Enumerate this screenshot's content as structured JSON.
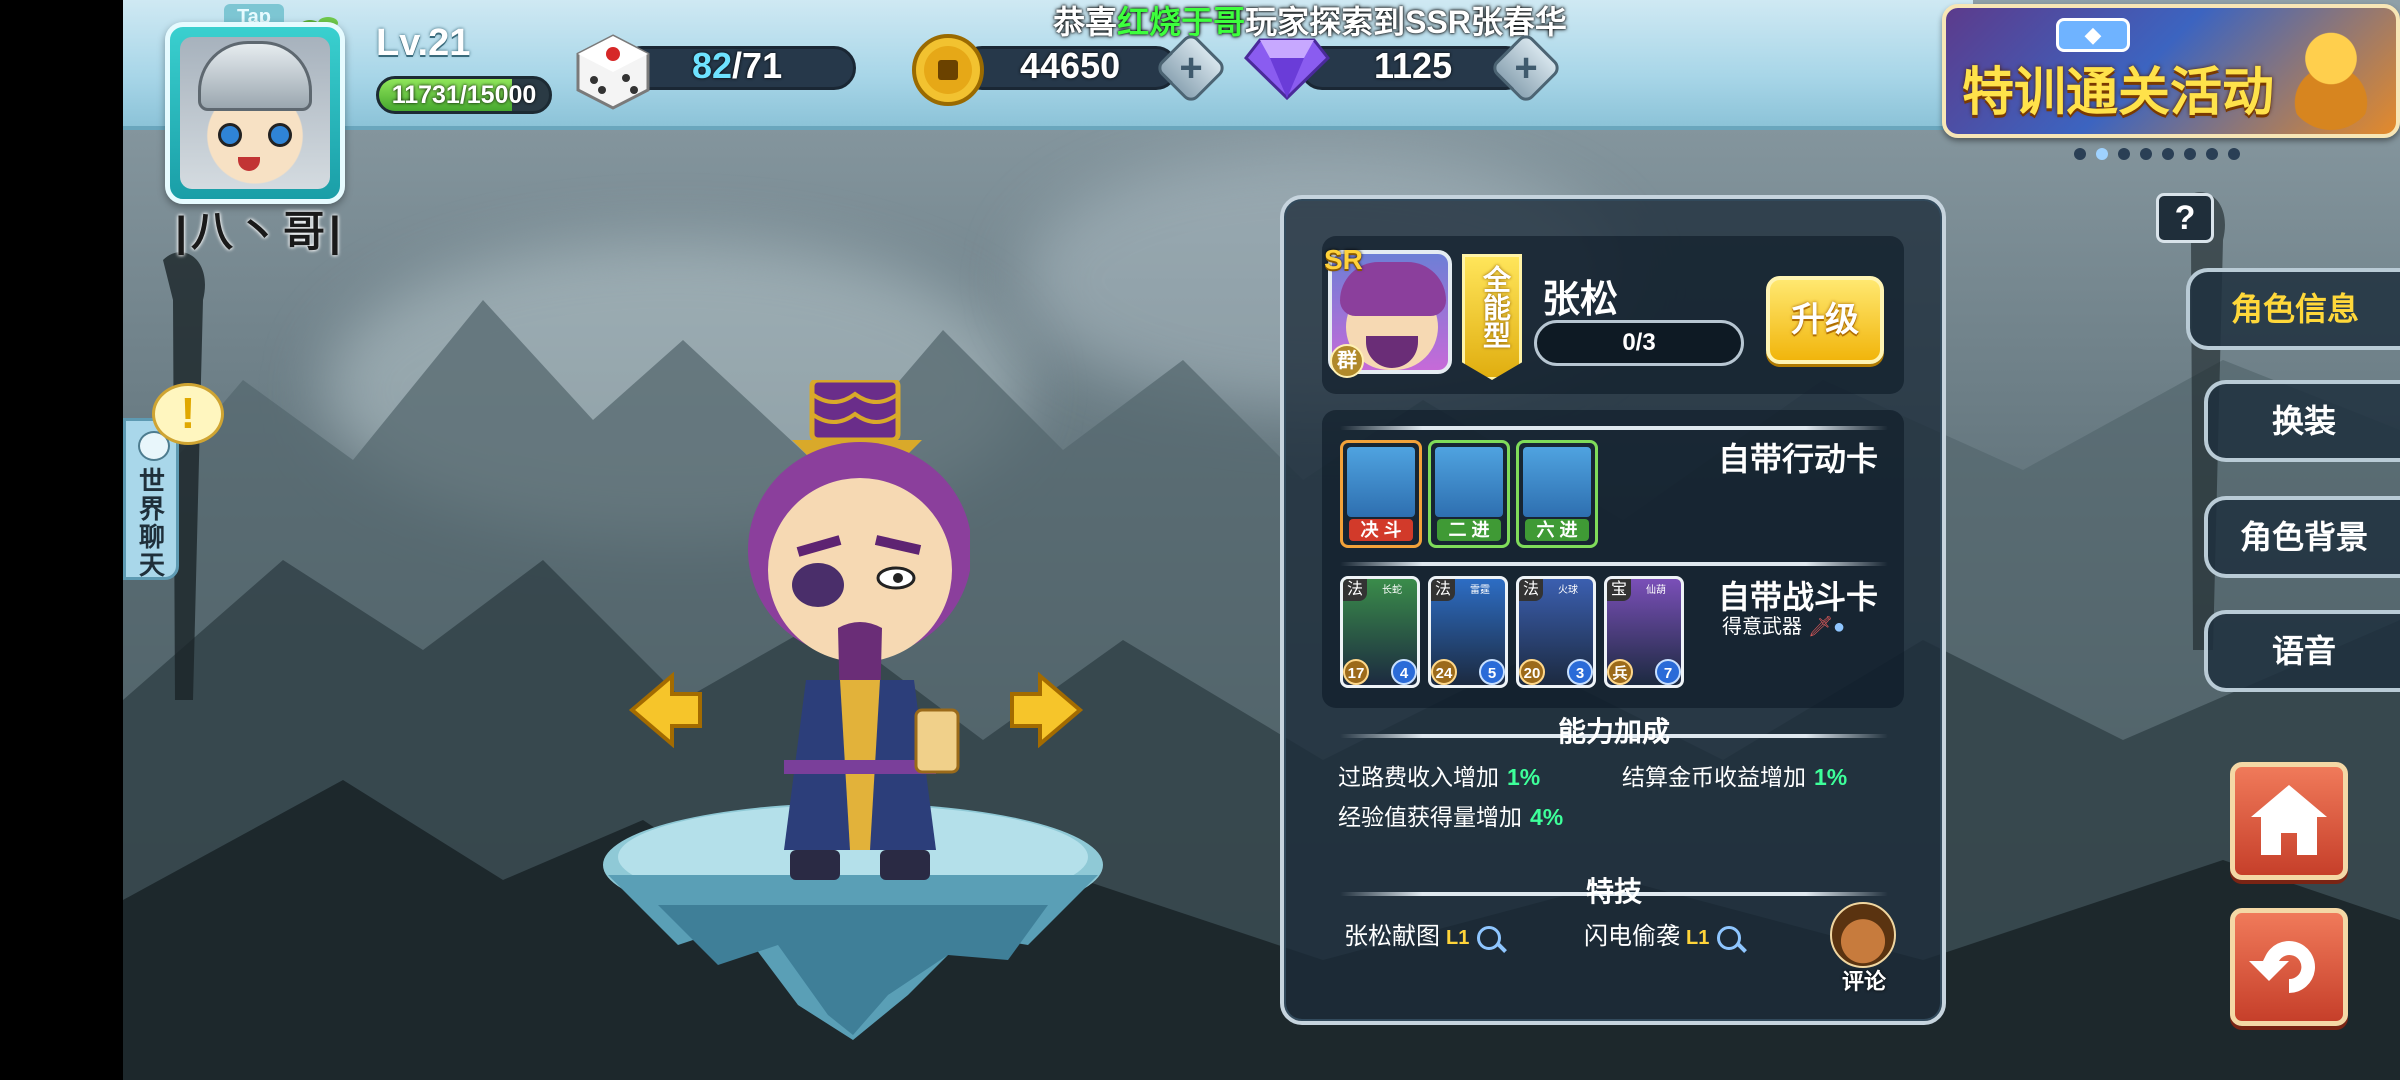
{
  "announcement": {
    "prefix": "恭喜",
    "player": "红烧于哥",
    "suffix": "玩家探索到SSR张春华"
  },
  "player": {
    "tap_label": "Tap",
    "name": "|八丶哥|",
    "level": "Lv.21",
    "exp_text": "11731/15000",
    "exp_fraction": 0.782
  },
  "resources": {
    "dice": {
      "current": "82",
      "max": "/71"
    },
    "coins": "44650",
    "gems": "1125"
  },
  "event_banner": {
    "title": "特训通关活动",
    "page_count": 8,
    "active_page": 2
  },
  "world_chat": {
    "label": "世界聊天",
    "alert": "!"
  },
  "help": "?",
  "hero": {
    "rarity": "SR",
    "faction": "群",
    "type": "全能型",
    "name": "张松",
    "stars": "0/3",
    "upgrade_label": "升级"
  },
  "action_cards": {
    "title": "自带行动卡",
    "cards": [
      {
        "label": "决 斗",
        "color": "#d23a2a"
      },
      {
        "label": "二 进",
        "color": "#3f9a35"
      },
      {
        "label": "六 进",
        "color": "#3f9a35"
      }
    ]
  },
  "battle_cards": {
    "title": "自带战斗卡",
    "weapon_label": "得意武器",
    "cards": [
      {
        "kind": "法",
        "name": "长蛇",
        "cost": "17",
        "power": "4",
        "color": "#3a8c4a"
      },
      {
        "kind": "法",
        "name": "雷霆",
        "cost": "24",
        "power": "5",
        "color": "#2d6dc4"
      },
      {
        "kind": "法",
        "name": "火球",
        "cost": "20",
        "power": "3",
        "color": "#3b5fb0"
      },
      {
        "kind": "宝",
        "name": "仙葫",
        "cost": "兵",
        "power": "7",
        "color": "#7a4fb8"
      }
    ]
  },
  "ability_bonus": {
    "title": "能力加成",
    "items": [
      {
        "label": "过路费收入增加",
        "value": "1%"
      },
      {
        "label": "结算金币收益增加",
        "value": "1%"
      },
      {
        "label": "经验值获得量增加",
        "value": "4%"
      }
    ]
  },
  "skills": {
    "title": "特技",
    "items": [
      {
        "name": "张松献图",
        "level": "L1"
      },
      {
        "name": "闪电偷袭",
        "level": "L1"
      }
    ]
  },
  "comment_label": "评论",
  "side_tabs": [
    {
      "label": "角色信息",
      "active": true
    },
    {
      "label": "换装",
      "active": false
    },
    {
      "label": "角色背景",
      "active": false
    },
    {
      "label": "语音",
      "active": false
    }
  ],
  "colors": {
    "accent": "#ffd83a",
    "highlight_green": "#3dff3d",
    "bonus_green": "#3dff9a"
  }
}
